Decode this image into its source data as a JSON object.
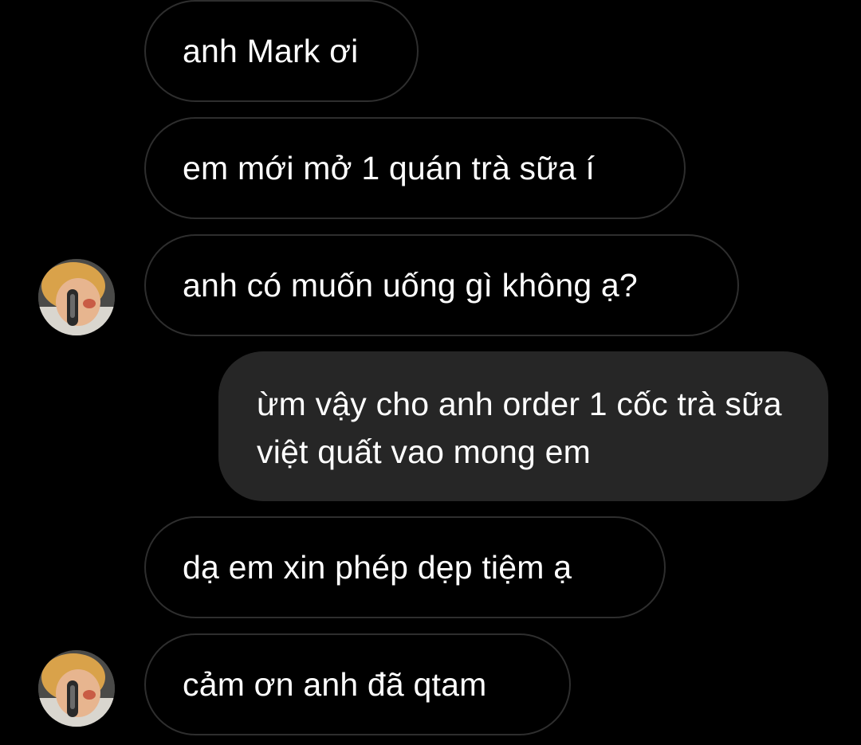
{
  "conversation": {
    "messages": [
      {
        "direction": "received",
        "text": "anh Mark ơi"
      },
      {
        "direction": "received",
        "text": "em mới mở 1 quán trà sữa í"
      },
      {
        "direction": "received",
        "text": "anh có muốn uống gì không ạ?",
        "show_avatar": true
      },
      {
        "direction": "sent",
        "text": "ừm vậy cho anh order 1 cốc trà sữa việt quất vao mong em"
      },
      {
        "direction": "received",
        "text": "dạ em xin phép dẹp tiệm ạ"
      },
      {
        "direction": "received",
        "text": "cảm ơn anh đã qtam",
        "show_avatar": true
      }
    ]
  },
  "colors": {
    "background": "#000000",
    "received_bubble_border": "#2e2e2e",
    "sent_bubble_fill": "#262626",
    "text": "#ffffff"
  },
  "icons": {
    "contact_avatar": "avatar-icon"
  }
}
